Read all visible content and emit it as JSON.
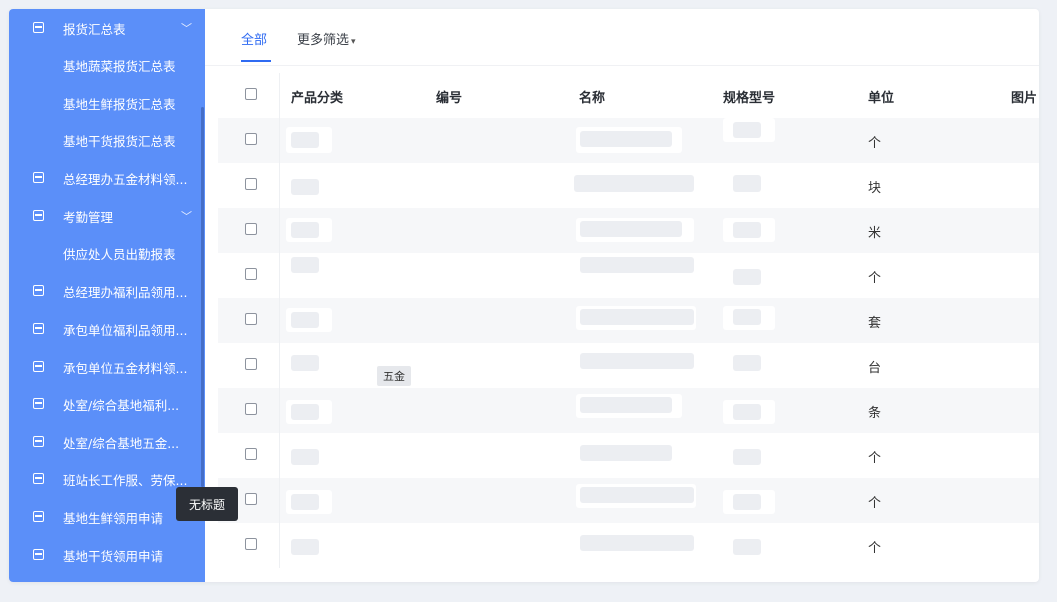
{
  "sidebar": {
    "items": [
      {
        "label": "报货汇总表",
        "type": "group",
        "expanded": true
      },
      {
        "label": "基地蔬菜报货汇总表",
        "type": "sub"
      },
      {
        "label": "基地生鲜报货汇总表",
        "type": "sub"
      },
      {
        "label": "基地干货报货汇总表",
        "type": "sub"
      },
      {
        "label": "总经理办五金材料领...",
        "type": "item"
      },
      {
        "label": "考勤管理",
        "type": "group",
        "expanded": true
      },
      {
        "label": "供应处人员出勤报表",
        "type": "sub"
      },
      {
        "label": "总经理办福利品领用...",
        "type": "item"
      },
      {
        "label": "承包单位福利品领用...",
        "type": "item"
      },
      {
        "label": "承包单位五金材料领...",
        "type": "item"
      },
      {
        "label": "处室/综合基地福利...",
        "type": "item"
      },
      {
        "label": "处室/综合基地五金...",
        "type": "item"
      },
      {
        "label": "班站长工作服、劳保...",
        "type": "item"
      },
      {
        "label": "基地生鲜领用申请",
        "type": "item"
      },
      {
        "label": "基地干货领用申请",
        "type": "item"
      }
    ],
    "tooltip": "无标题"
  },
  "tabs": {
    "all": "全部",
    "more_filters": "更多筛选",
    "more_caret": "▾"
  },
  "table": {
    "headers": [
      "产品分类",
      "编号",
      "名称",
      "规格型号",
      "单位",
      "图片"
    ],
    "units": [
      "个",
      "块",
      "米",
      "个",
      "套",
      "台",
      "条",
      "个",
      "个",
      "个"
    ],
    "tag": "五金"
  },
  "colors": {
    "sidebar_bg": "#5b8ff9",
    "accent": "#2f6bf2"
  }
}
